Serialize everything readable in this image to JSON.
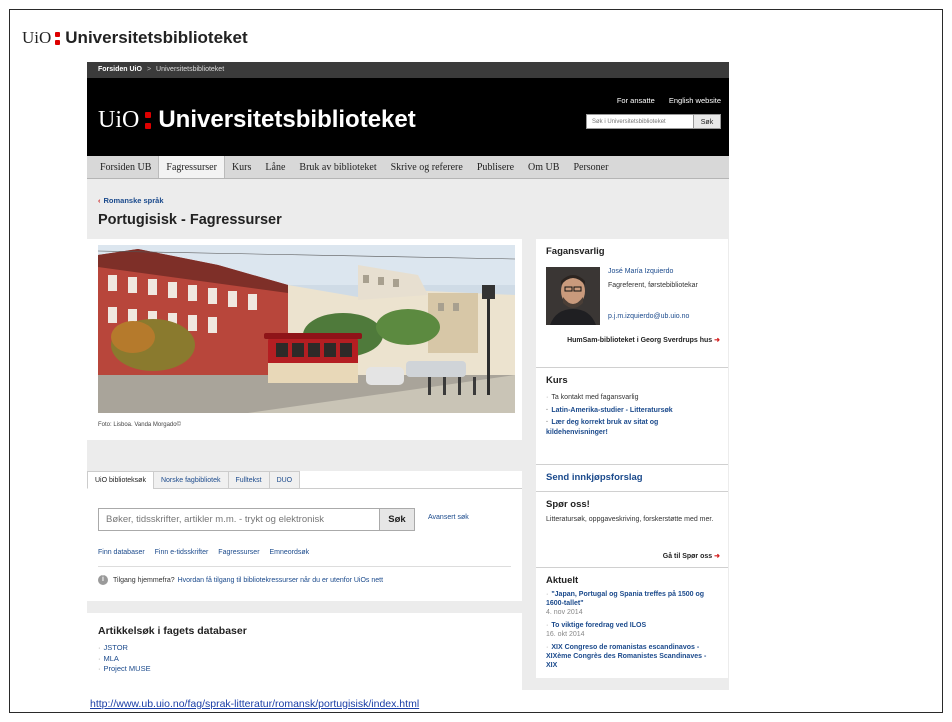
{
  "slide": {
    "uio": "UiO",
    "title": "Universitetsbiblioteket",
    "url": "http://www.ub.uio.no/fag/sprak-litteratur/romansk/portugisisk/index.html"
  },
  "site": {
    "crumbs": {
      "home": "Forsiden UiO",
      "sep": ">",
      "current": "Universitetsbiblioteket"
    },
    "logo_uio": "UiO",
    "logo_name": "Universitetsbiblioteket",
    "toplinks": [
      "For ansatte",
      "English website"
    ],
    "search": {
      "placeholder": "Søk i Universitetsbiblioteket",
      "button": "Søk"
    },
    "nav": [
      {
        "label": "Forsiden UB"
      },
      {
        "label": "Fagressurser",
        "active": true
      },
      {
        "label": "Kurs"
      },
      {
        "label": "Låne"
      },
      {
        "label": "Bruk av biblioteket"
      },
      {
        "label": "Skrive og referere"
      },
      {
        "label": "Publisere"
      },
      {
        "label": "Om UB"
      },
      {
        "label": "Personer"
      }
    ],
    "accent_color": "#dd0000",
    "link_color": "#1b4a8c"
  },
  "page": {
    "back_link": "Romanske språk",
    "title": "Portugisisk - Fagressurser",
    "photo_caption": "Foto: Lisboa. Vanda Morgado©"
  },
  "search_panel": {
    "tabs": [
      "UiO biblioteksøk",
      "Norske fagbibliotek",
      "Fulltekst",
      "DUO"
    ],
    "placeholder": "Bøker, tidsskrifter, artikler m.m. - trykt og elektronisk",
    "button": "Søk",
    "advanced": "Avansert søk",
    "quicklinks": [
      "Finn databaser",
      "Finn e-tidsskrifter",
      "Fagressurser",
      "Emneordsøk"
    ],
    "access_text": "Tilgang hjemmefra?",
    "access_link": "Hvordan få tilgang til bibliotekressurser når du er utenfor UiOs nett"
  },
  "articles": {
    "title": "Artikkelsøk i fagets databaser",
    "items": [
      "JSTOR",
      "MLA",
      "Project MUSE"
    ]
  },
  "sidebar": {
    "fagansvarlig": {
      "title": "Fagansvarlig",
      "name": "José María Izquierdo",
      "role": "Fagreferent, førstebibliotekar",
      "email": "p.j.m.izquierdo@ub.uio.no",
      "location": "HumSam-biblioteket i Georg Sverdrups hus"
    },
    "kurs": {
      "title": "Kurs",
      "items": [
        {
          "text": "Ta kontakt med fagansvarlig",
          "link": false
        },
        {
          "text": "Latin-Amerika-studier - Litteratursøk",
          "link": true
        },
        {
          "text": "Lær deg korrekt bruk av sitat og kildehenvisninger!",
          "link": true
        }
      ]
    },
    "innkjop": "Send innkjøpsforslag",
    "spor": {
      "title": "Spør oss!",
      "desc": "Litteratursøk, oppgaveskriving, forskerstøtte med mer.",
      "link": "Gå til Spør oss"
    },
    "aktuelt": {
      "title": "Aktuelt",
      "items": [
        {
          "headline": "\"Japan, Portugal og Spania treffes på 1500 og 1600-tallet\"",
          "date": "4. nov 2014"
        },
        {
          "headline": "To viktige foredrag ved ILOS",
          "date": "16. okt 2014"
        },
        {
          "headline": "XIX Congreso de romanistas escandinavos - XIXème Congrès des Romanistes Scandinaves - XIX",
          "date": ""
        }
      ]
    }
  }
}
